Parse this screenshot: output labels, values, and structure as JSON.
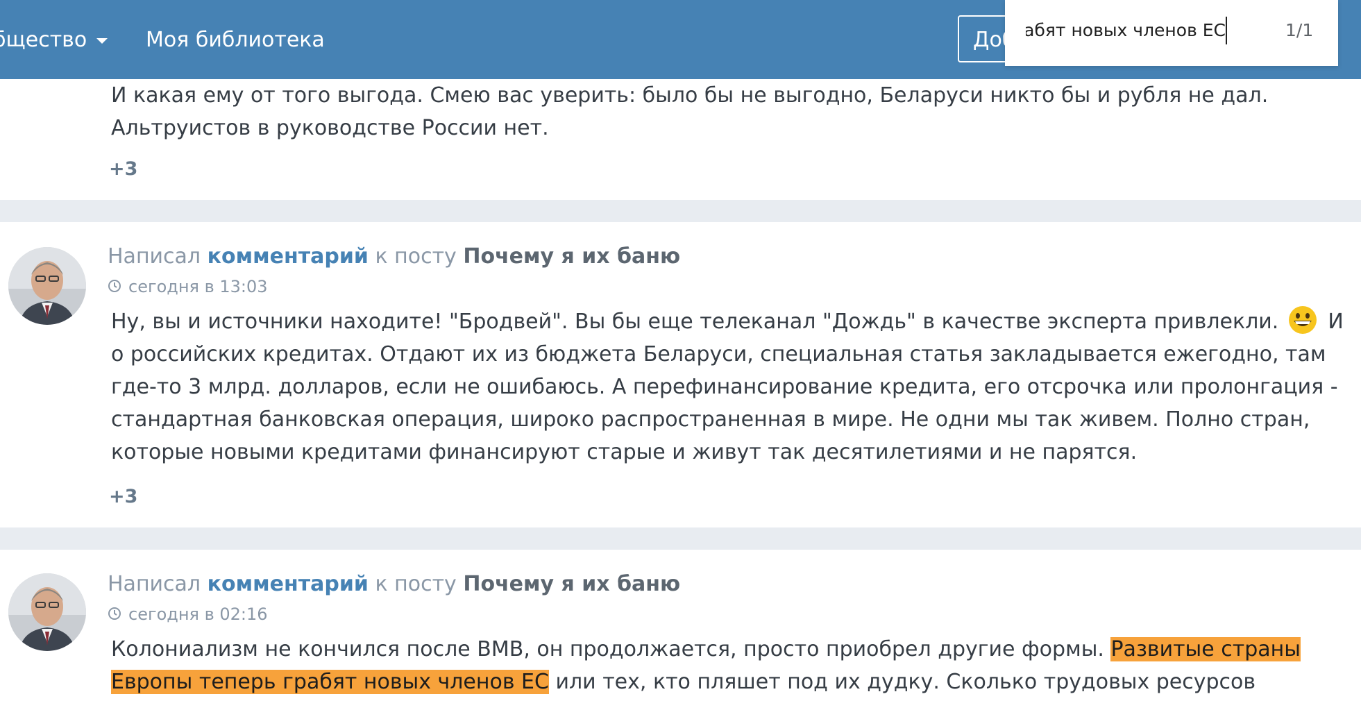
{
  "navbar": {
    "community_label": "бщество",
    "library_label": "Моя библиотека",
    "add_button_label": "Доб"
  },
  "findbar": {
    "query": "ь грабят новых членов ЕС",
    "match_count": "1/1"
  },
  "comments": [
    {
      "text": "И какая ему от того выгода. Смею вас уверить: было бы не выгодно, Беларуси никто бы и рубля не дал. Альтруистов в руководстве России нет.",
      "rating": "+3"
    },
    {
      "prefix": "Написал",
      "link_label": "комментарий",
      "middle": "к посту",
      "post_title": "Почему я их баню",
      "time": "сегодня в 13:03",
      "text_part1": "Ну, вы и источники находите! \"Бродвей\". Вы бы еще телеканал \"Дождь\" в качестве эксперта привлекли.",
      "text_part2": "И о российских кредитах. Отдают их из бюджета Беларуси, специальная статья закладывается ежегодно, там где-то 3 млрд. долларов, если не ошибаюсь. А перефинансирование кредита, его отсрочка или пролонгация - стандартная банковская операция, широко распространенная в мире. Не одни мы так живем. Полно стран, которые новыми кредитами финансируют старые и живут так десятилетиями и не парятся.",
      "rating": "+3"
    },
    {
      "prefix": "Написал",
      "link_label": "комментарий",
      "middle": "к посту",
      "post_title": "Почему я их баню",
      "time": "сегодня в 02:16",
      "text_before": "Колониализм не кончился после ВМВ, он продолжается, просто приобрел другие формы.",
      "text_highlight": "Развитые страны Европы теперь грабят новых членов ЕС",
      "text_after": "или тех, кто пляшет под их дудку. Сколько трудовых ресурсов потеряла Литва, Латвия,"
    }
  ],
  "colors": {
    "navbar": "#4682b4",
    "link": "#4682b4",
    "highlight": "#f7a23b",
    "page_bg": "#e8ecf1"
  }
}
